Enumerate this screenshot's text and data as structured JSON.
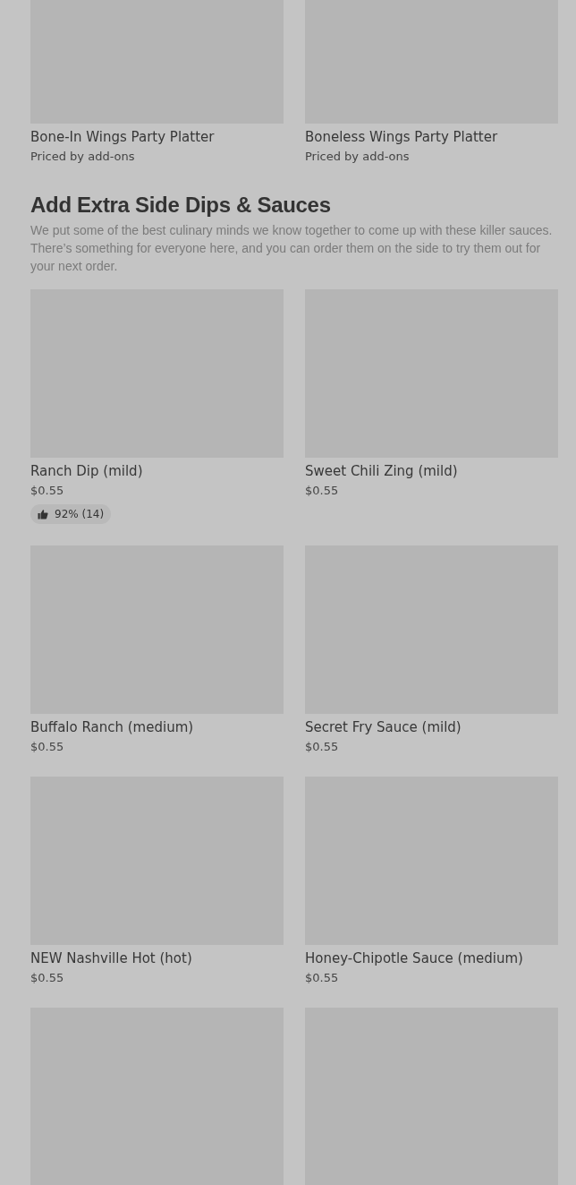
{
  "sections": [
    {
      "items": [
        {
          "name": "Bone-In Wings Party Platter",
          "price": "Priced by add-ons"
        },
        {
          "name": "Boneless Wings Party Platter",
          "price": "Priced by add-ons"
        }
      ]
    },
    {
      "title": "Add Extra Side Dips & Sauces",
      "description": "We put some of the best culinary minds we know together to come up with these killer sauces. There’s something for everyone here, and you can order them on the side to try them out for your next order.",
      "items": [
        {
          "name": "Ranch Dip (mild)",
          "price": "$0.55",
          "rating": "92% (14)"
        },
        {
          "name": "Sweet Chili Zing (mild)",
          "price": "$0.55"
        },
        {
          "name": "Buffalo Ranch (medium)",
          "price": "$0.55"
        },
        {
          "name": "Secret Fry Sauce (mild)",
          "price": "$0.55"
        },
        {
          "name": "NEW Nashville Hot (hot)",
          "price": "$0.55"
        },
        {
          "name": "Honey-Chipotle Sauce (medium)",
          "price": "$0.55"
        },
        {
          "kind": "image-only"
        },
        {
          "kind": "image-only"
        }
      ]
    }
  ]
}
